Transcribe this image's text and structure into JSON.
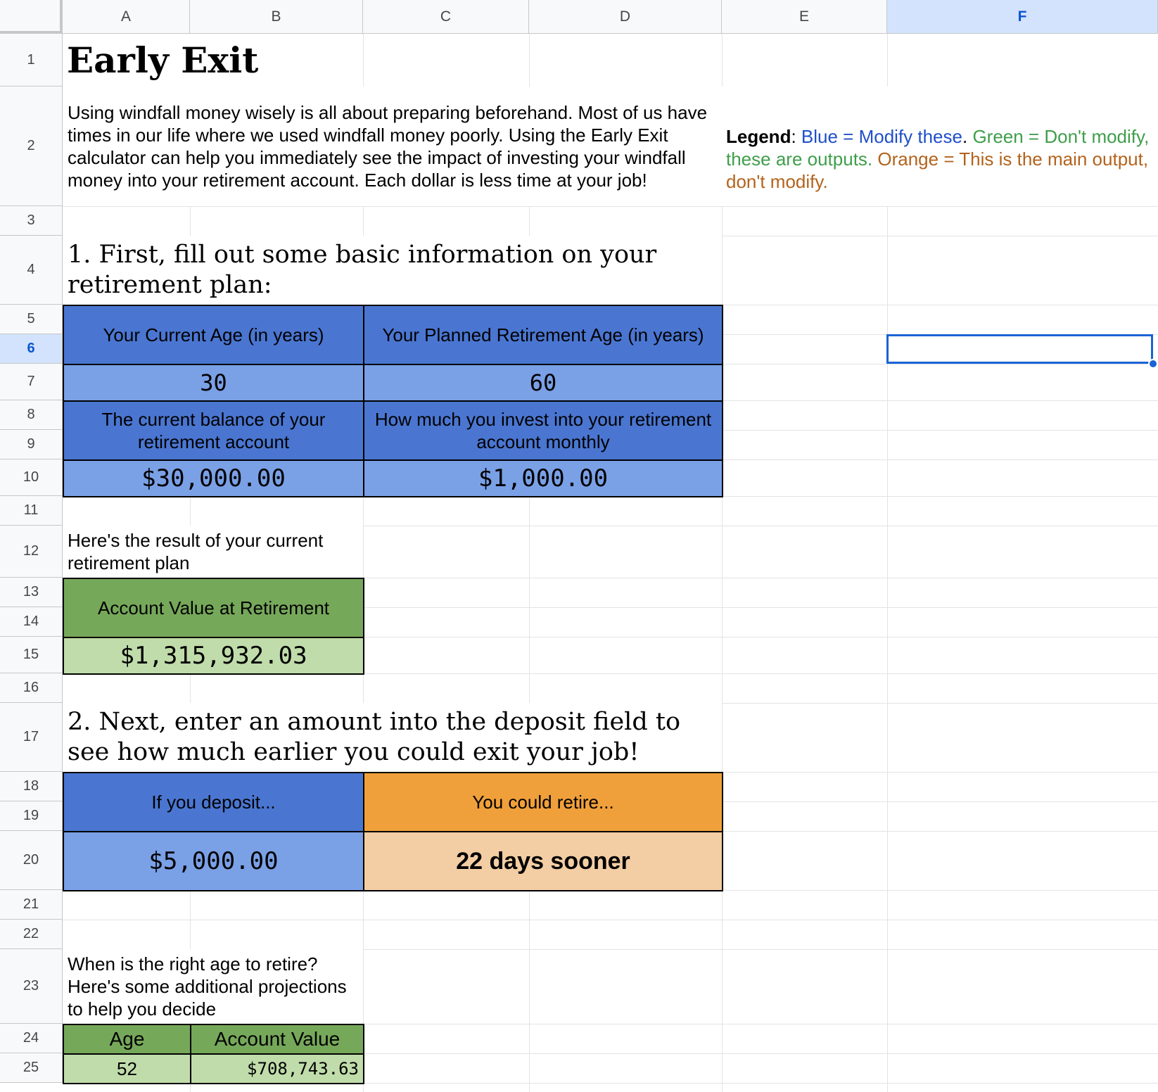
{
  "columns": [
    "A",
    "B",
    "C",
    "D",
    "E",
    "F"
  ],
  "rows": [
    "1",
    "2",
    "3",
    "4",
    "5",
    "6",
    "7",
    "8",
    "9",
    "10",
    "11",
    "12",
    "13",
    "14",
    "15",
    "16",
    "17",
    "18",
    "19",
    "20",
    "21",
    "22",
    "23",
    "24",
    "25"
  ],
  "selected_cell": "F6",
  "title": "Early Exit",
  "intro": "Using windfall money wisely is all about preparing beforehand. Most of us have times in our life where we used windfall money poorly. Using the Early Exit calculator can help you immediately see the impact of investing your windfall money into your retirement account. Each dollar is less time at your job!",
  "legend": {
    "label": "Legend",
    "sep1": ": ",
    "blue": "Blue = Modify these",
    "sep2": ". ",
    "green": "Green = Don't modify, these are outputs.",
    "sep3": " ",
    "orange": "Orange = This is the main output, don't modify."
  },
  "step1": {
    "heading": "1. First, fill out some basic information on your retirement plan:",
    "current_age_label": "Your Current Age (in years)",
    "current_age": "30",
    "retire_age_label": "Your Planned Retirement Age (in years)",
    "retire_age": "60",
    "balance_label": "The current balance of your retirement account",
    "balance": "$30,000.00",
    "monthly_label": "How much you invest into your retirement account monthly",
    "monthly": "$1,000.00"
  },
  "result": {
    "heading": "Here's the result of your current retirement plan",
    "label": "Account Value at Retirement",
    "value": "$1,315,932.03"
  },
  "step2": {
    "heading": "2. Next, enter an amount into the deposit field to see how much earlier you could exit your job!",
    "deposit_label": "If you deposit...",
    "deposit": "$5,000.00",
    "retire_label": "You could retire...",
    "retire_value": "22 days sooner"
  },
  "projections": {
    "heading": "When is the right age to retire? Here's some additional projections to help you decide",
    "age_header": "Age",
    "value_header": "Account Value",
    "rows": [
      {
        "age": "52",
        "value": "$708,743.63"
      }
    ]
  },
  "colors": {
    "blue_header": "#4a76d1",
    "blue_value": "#7aa0e6",
    "green_header": "#76a85a",
    "green_value": "#c0dcaa",
    "orange_header": "#f0a03a",
    "orange_value": "#f3cda3",
    "selection": "#1a63d6"
  }
}
